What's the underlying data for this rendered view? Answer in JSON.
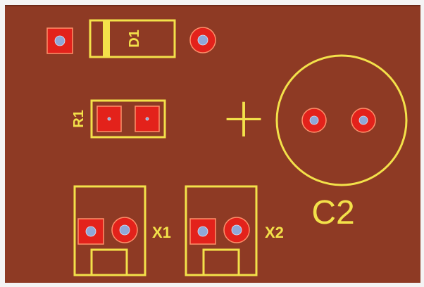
{
  "board": {
    "colors": {
      "substrate": "#8e3a24",
      "board_edge": "#6e2a18",
      "outer_bg": "#f4f4f4",
      "silkscreen": "#f3e14a",
      "pad_copper": "#e3221b",
      "pad_outline": "#ff8f6a",
      "drill_hole": "#8fa8d8"
    },
    "components": {
      "d1": {
        "designator": "D1"
      },
      "r1": {
        "designator": "R1"
      },
      "c2": {
        "designator": "C2",
        "polarity_mark": "+"
      },
      "x1": {
        "designator": "X1"
      },
      "x2": {
        "designator": "X2"
      }
    }
  }
}
